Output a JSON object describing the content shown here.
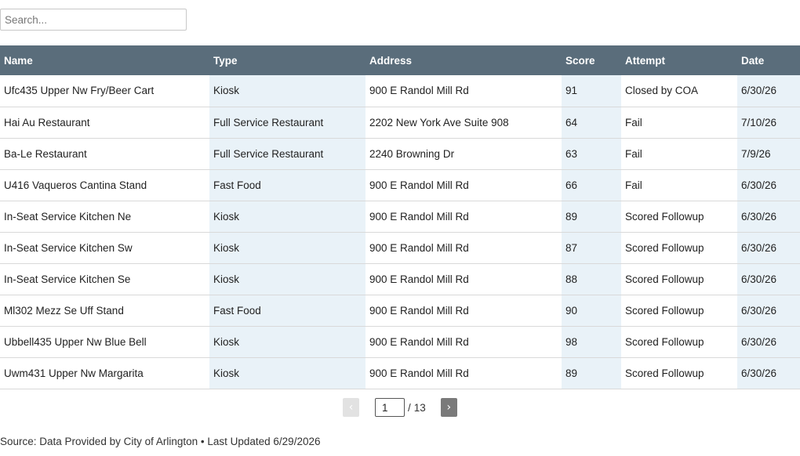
{
  "search": {
    "placeholder": "Search..."
  },
  "table": {
    "columns": [
      "Name",
      "Type",
      "Address",
      "Score",
      "Attempt",
      "Date"
    ],
    "rows": [
      [
        "Ufc435 Upper Nw Fry/Beer Cart",
        "Kiosk",
        "900 E Randol Mill Rd",
        "91",
        "Closed by COA",
        "6/30/26"
      ],
      [
        "Hai Au Restaurant",
        "Full Service Restaurant",
        "2202 New York Ave Suite 908",
        "64",
        "Fail",
        "7/10/26"
      ],
      [
        "Ba-Le Restaurant",
        "Full Service Restaurant",
        "2240 Browning Dr",
        "63",
        "Fail",
        "7/9/26"
      ],
      [
        "U416 Vaqueros Cantina Stand",
        "Fast Food",
        "900 E Randol Mill Rd",
        "66",
        "Fail",
        "6/30/26"
      ],
      [
        "In-Seat Service Kitchen Ne",
        "Kiosk",
        "900 E Randol Mill Rd",
        "89",
        "Scored Followup",
        "6/30/26"
      ],
      [
        "In-Seat Service Kitchen Sw",
        "Kiosk",
        "900 E Randol Mill Rd",
        "87",
        "Scored Followup",
        "6/30/26"
      ],
      [
        "In-Seat Service Kitchen Se",
        "Kiosk",
        "900 E Randol Mill Rd",
        "88",
        "Scored Followup",
        "6/30/26"
      ],
      [
        "Ml302 Mezz Se Uff Stand",
        "Fast Food",
        "900 E Randol Mill Rd",
        "90",
        "Scored Followup",
        "6/30/26"
      ],
      [
        "Ubbell435 Upper Nw Blue Bell",
        "Kiosk",
        "900 E Randol Mill Rd",
        "98",
        "Scored Followup",
        "6/30/26"
      ],
      [
        "Uwm431 Upper Nw Margarita",
        "Kiosk",
        "900 E Randol Mill Rd",
        "89",
        "Scored Followup",
        "6/30/26"
      ]
    ]
  },
  "pagination": {
    "prev_label": "‹",
    "next_label": "›",
    "current_page": "1",
    "separator": "/",
    "total_pages": "13"
  },
  "footer": {
    "source_text": "Source: Data Provided by City of Arlington • Last Updated 6/29/2026"
  },
  "colors": {
    "header_bg": "#5a6d7b",
    "shaded_column_bg": "#e9f2f8",
    "next_button_bg": "#7a7a7a",
    "prev_button_bg": "#e2e2e2"
  }
}
